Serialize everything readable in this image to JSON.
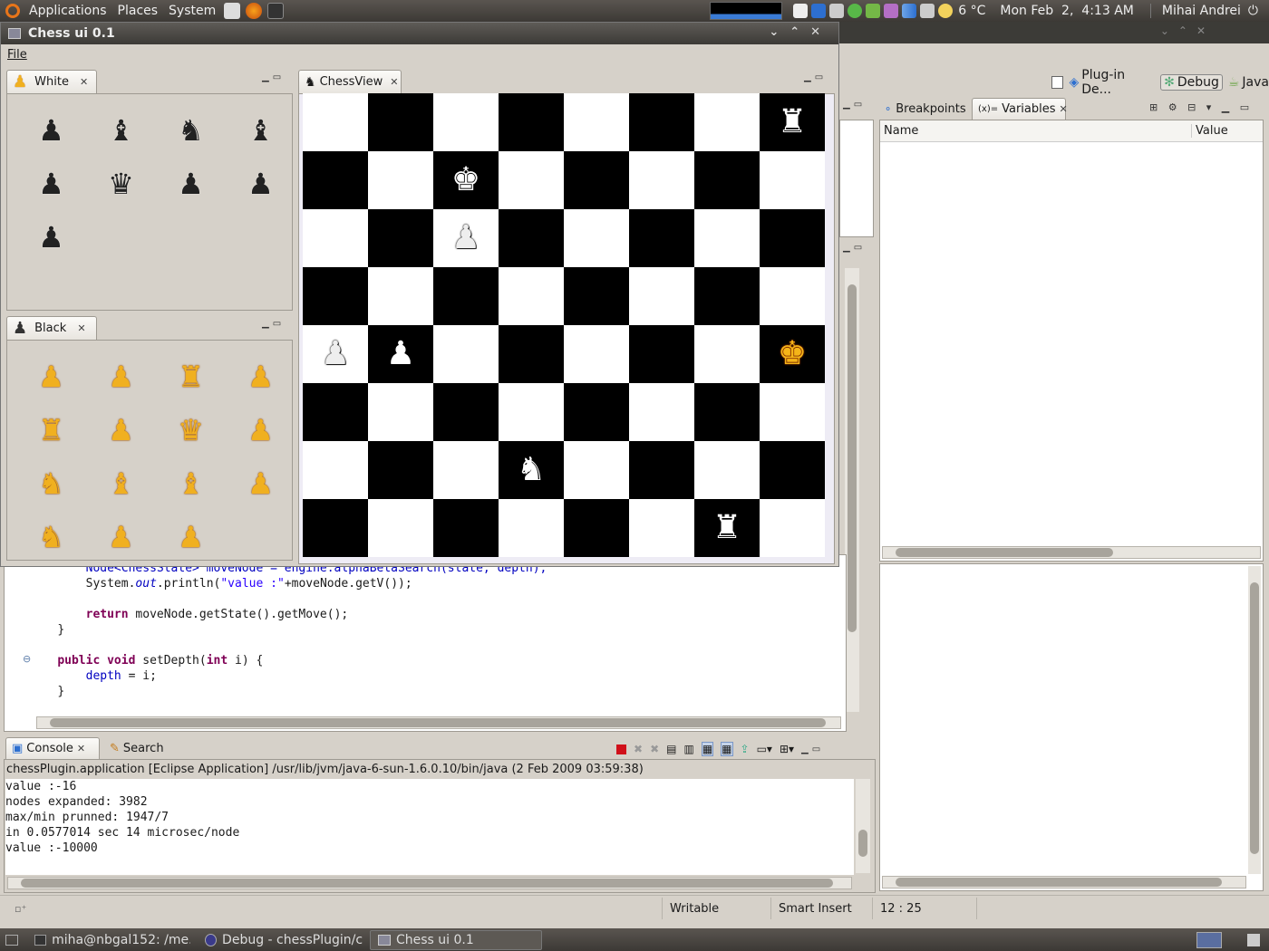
{
  "top_panel": {
    "menus": [
      "Applications",
      "Places",
      "System"
    ],
    "weather": "6 °C",
    "clock": "Mon Feb  2,  4:13 AM",
    "user": "Mihai Andrei"
  },
  "chess_window": {
    "title": "Chess ui 0.1",
    "menu_file": "File",
    "white_tab": "White",
    "black_tab": "Black",
    "board_tab": "ChessView",
    "white_captured": [
      "♟",
      "♝",
      "♞",
      "♝",
      "♟",
      "♛",
      "♟",
      "♟",
      "♟"
    ],
    "black_captured": [
      "♟",
      "♟",
      "♜",
      "♟",
      "♜",
      "♟",
      "♛",
      "♟",
      "♞",
      "♝",
      "♝",
      "♟",
      "♞",
      "♟",
      "♟"
    ],
    "board": [
      [
        "",
        "",
        "",
        "",
        "",
        "",
        "",
        "w:♜"
      ],
      [
        "",
        "",
        "w:♚",
        "",
        "",
        "",
        "",
        ""
      ],
      [
        "",
        "",
        "w:♟",
        "",
        "",
        "",
        "",
        ""
      ],
      [
        "",
        "",
        "",
        "",
        "",
        "",
        "",
        ""
      ],
      [
        "w:♟",
        "w:♟",
        "",
        "",
        "",
        "",
        "",
        "o:♚"
      ],
      [
        "",
        "",
        "",
        "",
        "",
        "",
        "",
        ""
      ],
      [
        "",
        "",
        "",
        "w:♞",
        "",
        "",
        "",
        ""
      ],
      [
        "",
        "",
        "",
        "",
        "",
        "",
        "w:♜",
        ""
      ]
    ]
  },
  "eclipse": {
    "perspectives": [
      "Plug-in De...",
      "Debug",
      "Java"
    ],
    "debug_tabs": [
      "Breakpoints",
      "Variables"
    ],
    "variables_columns": [
      "Name",
      "Value"
    ],
    "code_lines": [
      {
        "indent": "        ",
        "parts": [
          [
            "fld",
            "Node<ChessState> moveNode = engine.alphaBetaSearch(state, depth);"
          ]
        ]
      },
      {
        "indent": "        ",
        "parts": [
          [
            "",
            "System."
          ],
          [
            "it",
            "out"
          ],
          [
            "",
            ".println("
          ],
          [
            "str",
            "\"value :\""
          ],
          [
            "",
            "+moveNode.getV());"
          ]
        ]
      },
      {
        "indent": "",
        "parts": [
          [
            "",
            ""
          ]
        ]
      },
      {
        "indent": "        ",
        "parts": [
          [
            "kw",
            "return"
          ],
          [
            "",
            " moveNode.getState().getMove();"
          ]
        ]
      },
      {
        "indent": "    ",
        "parts": [
          [
            "",
            "}"
          ]
        ]
      },
      {
        "indent": "",
        "parts": [
          [
            "",
            ""
          ]
        ]
      },
      {
        "indent": "    ",
        "parts": [
          [
            "kw",
            "public"
          ],
          [
            "",
            " "
          ],
          [
            "kw",
            "void"
          ],
          [
            "",
            " setDepth("
          ],
          [
            "kw",
            "int"
          ],
          [
            "",
            " i) {"
          ]
        ]
      },
      {
        "indent": "        ",
        "parts": [
          [
            "fld",
            "depth"
          ],
          [
            "",
            " = i;"
          ]
        ]
      },
      {
        "indent": "    ",
        "parts": [
          [
            "",
            "}"
          ]
        ]
      }
    ],
    "console_tabs": [
      "Console",
      "Search"
    ],
    "console_header": "chessPlugin.application [Eclipse Application] /usr/lib/jvm/java-6-sun-1.6.0.10/bin/java (2 Feb 2009 03:59:38)",
    "console_lines": [
      "value :-16",
      "nodes expanded: 3982",
      "max/min prunned: 1947/7",
      "in 0.0577014 sec 14 microsec/node",
      "value :-10000"
    ],
    "status_writable": "Writable",
    "status_insert": "Smart Insert",
    "status_position": "12 : 25"
  },
  "taskbar": {
    "tasks": [
      "miha@nbgal152: /me...",
      "Debug - chessPlugin/c...",
      "Chess ui 0.1"
    ]
  },
  "colors": {
    "dark_square": "#000000",
    "light_square": "#ffffff",
    "orange_piece": "#f5b518",
    "panel_bg": "#d6d1c9"
  }
}
